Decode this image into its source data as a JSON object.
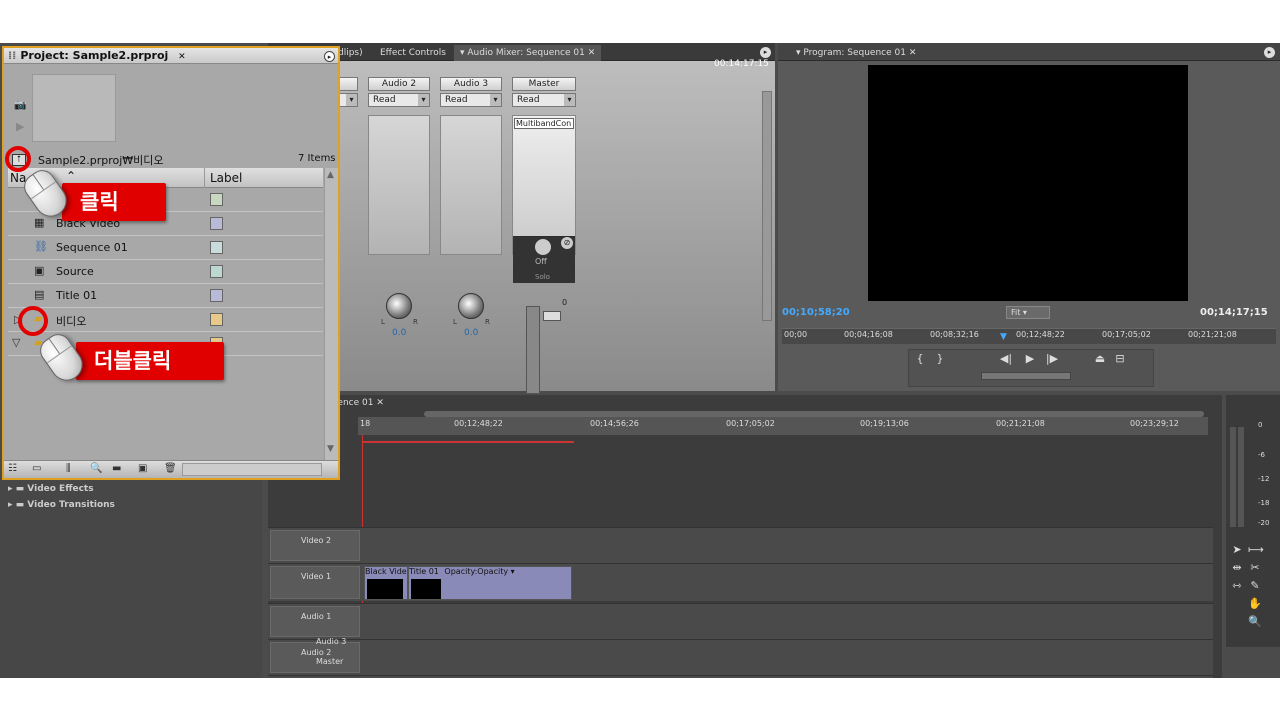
{
  "project": {
    "tab": "Project: Sample2.prproj",
    "path": "Sample2.prproj₩비디오",
    "count": "7 Items",
    "col_name": "Na",
    "col_label": "Label",
    "rows": [
      {
        "name": "Black Video",
        "color": "#b9b9d8"
      },
      {
        "name": "Sequence 01",
        "color": "#c9dcdc"
      },
      {
        "name": "Source",
        "color": "#bcd8d0"
      },
      {
        "name": "Title 01",
        "color": "#b9b9d8"
      },
      {
        "name": "비디오",
        "color": "#e8c98a"
      },
      {
        "name": "",
        "color": "#e8c98a"
      }
    ],
    "row0_color": "#c8d8c0"
  },
  "callouts": {
    "click": "클릭",
    "dblclick": "더블클릭"
  },
  "tabs": {
    "clips": "dlips)",
    "effect_controls": "Effect Controls",
    "audio_mixer": "Audio Mixer: Sequence 01",
    "program": "Program: Sequence 01",
    "timeline": "quence 01"
  },
  "mixer": {
    "timecode": "00:14:17:15",
    "channels": [
      {
        "name": "",
        "mode": ""
      },
      {
        "name": "Audio 2",
        "mode": "Read"
      },
      {
        "name": "Audio 3",
        "mode": "Read"
      },
      {
        "name": "Master",
        "mode": "Read"
      }
    ],
    "effect": "MultibandCon",
    "knob_off": "Off",
    "solo": "Solo",
    "pan2": "0.0",
    "pan3": "0.0",
    "zero": "0",
    "L": "L",
    "R": "R"
  },
  "program": {
    "tc_left": "00;10;58;20",
    "fit": "Fit",
    "tc_right": "00;14;17;15",
    "ruler": [
      "00;00",
      "00;04;16;08",
      "00;08;32;16",
      "00;12;48;22",
      "00;17;05;02",
      "00;21;21;08"
    ]
  },
  "timeline": {
    "ruler": [
      "00;12;48;22",
      "00;14;56;26",
      "00;17;05;02",
      "00;19;13;06",
      "00;21;21;08",
      "00;23;29;12"
    ],
    "start": "18",
    "tracks": [
      "Video 2",
      "Video 1",
      "Audio 1",
      "Audio 2",
      "Audio 3",
      "Master"
    ],
    "clips": [
      "Black Vide",
      "Title 01",
      "Opacity:Opacity ▾"
    ]
  },
  "effects": [
    "Video Effects",
    "Video Transitions"
  ],
  "meter": [
    "0",
    "-6",
    "-12",
    "-18",
    "-20"
  ]
}
